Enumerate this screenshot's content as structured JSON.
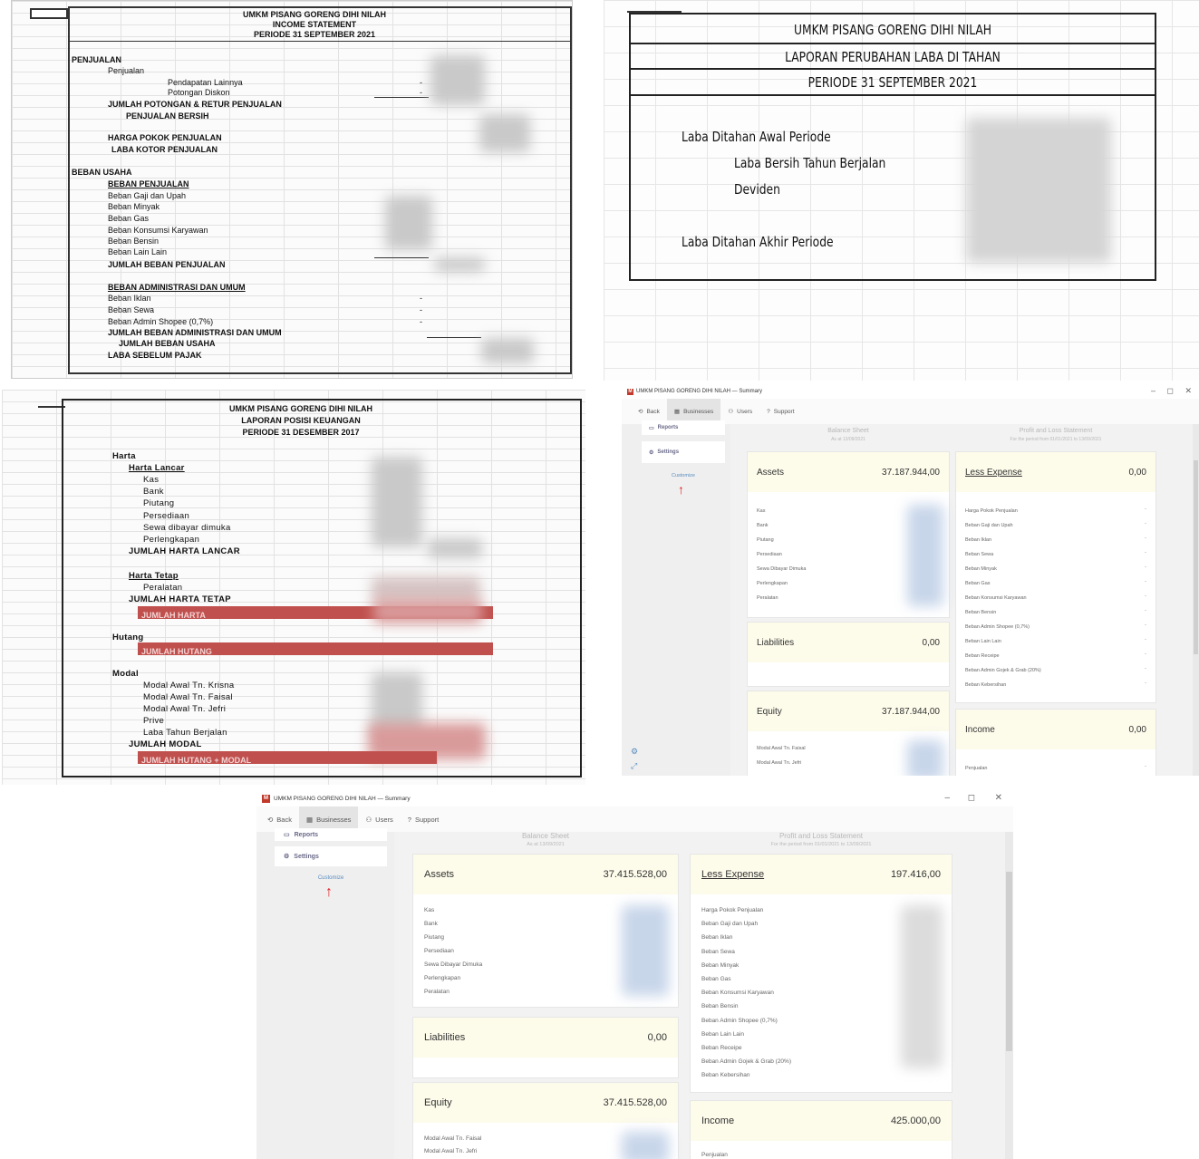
{
  "income_statement": {
    "header": [
      "UMKM PISANG GORENG DIHI NILAH",
      "INCOME STATEMENT",
      "PERIODE 31 SEPTEMBER 2021"
    ],
    "penjualan": "PENJUALAN",
    "penjualan_sub": "Penjualan",
    "pendapatan_lainnya": "Pendapatan Lainnya",
    "potongan_diskon": "Potongan Diskon",
    "jumlah_potongan": "JUMLAH POTONGAN & RETUR PENJUALAN",
    "penjualan_bersih": "PENJUALAN BERSIH",
    "hpp": "HARGA POKOK PENJUALAN",
    "laba_kotor": "LABA KOTOR PENJUALAN",
    "beban_usaha": "BEBAN USAHA",
    "beban_penjualan": "BEBAN PENJUALAN",
    "beban_penjualan_items": [
      "Beban Gaji dan Upah",
      "Beban Minyak",
      "Beban Gas",
      "Beban Konsumsi Karyawan",
      "Beban Bensin",
      "Beban Lain Lain"
    ],
    "jumlah_beban_penjualan": "JUMLAH BEBAN PENJUALAN",
    "beban_adm": "BEBAN ADMINISTRASI DAN UMUM",
    "beban_adm_items": [
      "Beban Iklan",
      "Beban Sewa",
      "Beban Admin Shopee (0,7%)"
    ],
    "jumlah_beban_adm": "JUMLAH BEBAN ADMINISTRASI DAN UMUM",
    "jumlah_beban_usaha": "JUMLAH BEBAN USAHA",
    "laba_sebelum_pajak": "LABA SEBELUM PAJAK",
    "dash": "-"
  },
  "retained_earnings": {
    "header": [
      "UMKM PISANG GORENG DIHI NILAH",
      "LAPORAN PERUBAHAN LABA DI TAHAN",
      "PERIODE 31 SEPTEMBER 2021"
    ],
    "awal": "Laba Ditahan Awal Periode",
    "laba_bersih": "Laba Bersih Tahun Berjalan",
    "deviden": "Deviden",
    "akhir": "Laba Ditahan Akhir Periode"
  },
  "balance_sheet": {
    "header": [
      "UMKM PISANG GORENG DIHI NILAH",
      "LAPORAN POSISI KEUANGAN",
      "PERIODE 31 DESEMBER 2017"
    ],
    "harta": "Harta",
    "harta_lancar": "Harta Lancar",
    "harta_lancar_items": [
      "Kas",
      "Bank",
      "Piutang",
      "Persediaan",
      "Sewa dibayar dimuka",
      "Perlengkapan"
    ],
    "jumlah_harta_lancar": "JUMLAH HARTA LANCAR",
    "harta_tetap": "Harta Tetap",
    "peralatan": "Peralatan",
    "jumlah_harta_tetap": "JUMLAH HARTA TETAP",
    "jumlah_harta": "JUMLAH HARTA",
    "hutang": "Hutang",
    "jumlah_hutang": "JUMLAH HUTANG",
    "modal": "Modal",
    "modal_items": [
      "Modal Awal Tn. Krisna",
      "Modal Awal Tn. Faisal",
      "Modal Awal Tn. Jefri",
      "Prive",
      "Laba Tahun Berjalan"
    ],
    "jumlah_modal": "JUMLAH MODAL",
    "jumlah_hutang_modal": "JUMLAH HUTANG + MODAL"
  },
  "app1": {
    "title": "UMKM PISANG GORENG DIHI NILAH — Summary",
    "logo": "M",
    "controls": {
      "min": "–",
      "max": "◻",
      "close": "✕"
    },
    "toolbar": {
      "back": "Back",
      "businesses": "Businesses",
      "users": "Users",
      "support": "Support"
    },
    "sidebar": {
      "reports": "Reports",
      "settings": "Settings",
      "customize": "Customize"
    },
    "columns": {
      "balance": "Balance Sheet",
      "balance_sub": "As at 13/09/2021",
      "pl": "Profit and Loss Statement",
      "pl_sub": "For the period from 01/01/2021 to 13/09/2021"
    },
    "assets": {
      "label": "Assets",
      "value": "37.187.944,00",
      "rows": [
        "Kas",
        "Bank",
        "Piutang",
        "Persediaan",
        "Sewa Dibayar Dimuka",
        "Perlengkapan",
        "Peralatan"
      ]
    },
    "liabilities": {
      "label": "Liabilities",
      "value": "0,00"
    },
    "equity": {
      "label": "Equity",
      "value": "37.187.944,00",
      "rows": [
        "Modal Awal Tn. Faisal",
        "Modal Awal Tn. Jefri"
      ]
    },
    "less_expense": {
      "label": "Less Expense",
      "value": "0,00",
      "rows": [
        "Harga Pokok Penjualan",
        "Beban Gaji dan Upah",
        "Beban Iklan",
        "Beban Sewa",
        "Beban Minyak",
        "Beban Gas",
        "Beban Konsumsi Karyawan",
        "Beban Bensin",
        "Beban Admin Shopee (0,7%)",
        "Beban Lain Lain",
        "Beban Receipe",
        "Beban Admin Gojek & Grab (20%)",
        "Beban Kebersihan"
      ]
    },
    "income": {
      "label": "Income",
      "value": "0,00",
      "rows": [
        "Penjualan"
      ]
    }
  },
  "app2": {
    "title": "UMKM PISANG GORENG DIHI NILAH — Summary",
    "logo": "M",
    "controls": {
      "min": "–",
      "max": "◻",
      "close": "✕"
    },
    "toolbar": {
      "back": "Back",
      "businesses": "Businesses",
      "users": "Users",
      "support": "Support"
    },
    "sidebar": {
      "reports": "Reports",
      "settings": "Settings",
      "customize": "Customize"
    },
    "columns": {
      "balance": "Balance Sheet",
      "balance_sub": "As at 13/09/2021",
      "pl": "Profit and Loss Statement",
      "pl_sub": "For the period from 01/01/2021 to 13/09/2021"
    },
    "assets": {
      "label": "Assets",
      "value": "37.415.528,00",
      "rows": [
        "Kas",
        "Bank",
        "Piutang",
        "Persediaan",
        "Sewa Dibayar Dimuka",
        "Perlengkapan",
        "Peralatan"
      ]
    },
    "liabilities": {
      "label": "Liabilities",
      "value": "0,00"
    },
    "equity": {
      "label": "Equity",
      "value": "37.415.528,00",
      "rows": [
        "Modal Awal Tn. Faisal",
        "Modal Awal Tn. Jefri"
      ]
    },
    "less_expense": {
      "label": "Less Expense",
      "value": "197.416,00",
      "rows": [
        "Harga Pokok Penjualan",
        "Beban Gaji dan Upah",
        "Beban Iklan",
        "Beban Sewa",
        "Beban Minyak",
        "Beban Gas",
        "Beban Konsumsi Karyawan",
        "Beban Bensin",
        "Beban Admin Shopee (0,7%)",
        "Beban Lain Lain",
        "Beban Receipe",
        "Beban Admin Gojek & Grab (20%)",
        "Beban Kebersihan"
      ]
    },
    "income": {
      "label": "Income",
      "value": "425.000,00",
      "rows": [
        "Penjualan"
      ]
    }
  }
}
